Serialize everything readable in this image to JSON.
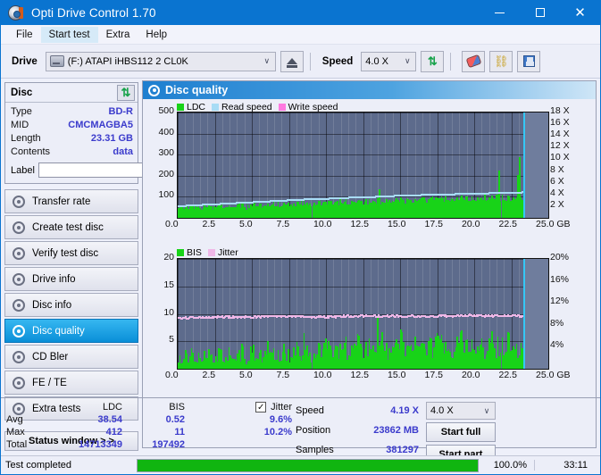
{
  "window": {
    "title": "Opti Drive Control 1.70",
    "icon": "disc-app-icon",
    "minimize": "–",
    "maximize": "□",
    "close": "✕"
  },
  "menu": {
    "items": [
      "File",
      "Start test",
      "Extra",
      "Help"
    ],
    "active": "Start test"
  },
  "toolbar": {
    "drive_label": "Drive",
    "drive_value": "(F:)  ATAPI iHBS112  2 CL0K",
    "eject_icon": "eject-icon",
    "speed_label": "Speed",
    "speed_value": "4.0 X",
    "refresh_icon": "refresh-icon",
    "erase_icon": "erase-icon",
    "chain_icon": "chain-icon",
    "save_icon": "save-icon",
    "caret": "∨"
  },
  "disc": {
    "header": "Disc",
    "refresh_icon": "refresh-icon",
    "rows": [
      {
        "key": "Type",
        "value": "BD-R"
      },
      {
        "key": "MID",
        "value": "CMCMAGBA5"
      },
      {
        "key": "Length",
        "value": "23.31 GB"
      },
      {
        "key": "Contents",
        "value": "data"
      }
    ],
    "label_key": "Label",
    "label_value": "",
    "label_placeholder": "",
    "disc_icon": "cd-icon"
  },
  "nav": {
    "items": [
      {
        "label": "Transfer rate",
        "selected": false
      },
      {
        "label": "Create test disc",
        "selected": false
      },
      {
        "label": "Verify test disc",
        "selected": false
      },
      {
        "label": "Drive info",
        "selected": false
      },
      {
        "label": "Disc info",
        "selected": false
      },
      {
        "label": "Disc quality",
        "selected": true
      },
      {
        "label": "CD Bler",
        "selected": false
      },
      {
        "label": "FE / TE",
        "selected": false
      },
      {
        "label": "Extra tests",
        "selected": false
      }
    ],
    "status_window": "Status window > >"
  },
  "chart_panel": {
    "title": "Disc quality",
    "icon": "disc-quality-icon"
  },
  "stats": {
    "columns": [
      "LDC",
      "BIS"
    ],
    "jitter_label": "Jitter",
    "jitter_checked": true,
    "checkmark": "✓",
    "rows": [
      {
        "name": "Avg",
        "ldc": "38.54",
        "bis": "0.52",
        "jitter": "9.6%"
      },
      {
        "name": "Max",
        "ldc": "412",
        "bis": "11",
        "jitter": "10.2%"
      },
      {
        "name": "Total",
        "ldc": "14713349",
        "bis": "197492",
        "jitter": ""
      }
    ],
    "right": [
      {
        "label": "Speed",
        "value": "4.19 X"
      },
      {
        "label": "Position",
        "value": "23862 MB"
      },
      {
        "label": "Samples",
        "value": "381297"
      }
    ],
    "speed_select": "4.0 X",
    "start_full": "Start full",
    "start_part": "Start part"
  },
  "statusbar": {
    "message": "Test completed",
    "progress_pct": 100,
    "progress_text": "100.0%",
    "elapsed": "33:11"
  },
  "colors": {
    "accent": "#0a74d0",
    "ldc_green": "#18d318",
    "read_speed": "#a8dcf5",
    "write_speed": "#ff7ae0",
    "jitter_pink": "#f0b8e8",
    "plot_bg": "#5d6b8c",
    "value_blue": "#3b3bcc",
    "progress_green": "#10b510"
  },
  "chart_data": [
    {
      "type": "area",
      "id": "disc-quality-ldc",
      "title": "Disc quality",
      "xlabel": "GB",
      "ylabel": "LDC",
      "xlim": [
        0,
        25.0
      ],
      "ylim": [
        0,
        500
      ],
      "y2lim": [
        0,
        18
      ],
      "y2label": "X",
      "xticks": [
        "0.0",
        "2.5",
        "5.0",
        "7.5",
        "10.0",
        "12.5",
        "15.0",
        "17.5",
        "20.0",
        "22.5",
        "25.0 GB"
      ],
      "yticks": [
        100,
        200,
        300,
        400,
        500
      ],
      "y2ticks": [
        "2 X",
        "4 X",
        "6 X",
        "8 X",
        "10 X",
        "12 X",
        "14 X",
        "16 X",
        "18 X"
      ],
      "grid": true,
      "legend": [
        {
          "name": "LDC",
          "color": "#18d318"
        },
        {
          "name": "Read speed",
          "color": "#a8dcf5"
        },
        {
          "name": "Write speed",
          "color": "#ff7ae0"
        }
      ],
      "series": [
        {
          "name": "LDC",
          "color": "#18d318",
          "x": [
            0.1,
            0.4,
            0.7,
            1.0,
            1.3,
            1.6,
            1.9,
            2.2,
            2.5,
            2.8,
            3.1,
            3.4,
            3.7,
            4.0,
            4.3,
            4.6,
            4.9,
            5.2,
            5.5,
            5.8,
            6.1,
            6.4,
            6.7,
            7.0,
            7.3,
            7.6,
            7.9,
            8.2,
            8.5,
            8.8,
            9.1,
            9.4,
            9.7,
            10.0,
            10.3,
            10.6,
            10.9,
            11.2,
            11.5,
            11.8,
            12.1,
            12.4,
            12.7,
            13.0,
            13.3,
            13.6,
            13.9,
            14.2,
            14.5,
            14.8,
            15.1,
            15.4,
            15.7,
            16.0,
            16.3,
            16.6,
            16.9,
            17.2,
            17.5,
            17.8,
            18.1,
            18.4,
            18.7,
            19.0,
            19.3,
            19.6,
            19.9,
            20.2,
            20.5,
            20.8,
            21.1,
            21.4,
            21.7,
            22.0,
            22.3,
            22.6,
            22.9,
            23.2
          ],
          "values": [
            58,
            62,
            55,
            60,
            70,
            64,
            58,
            66,
            72,
            61,
            60,
            75,
            190,
            80,
            68,
            72,
            66,
            90,
            70,
            74,
            68,
            120,
            76,
            82,
            70,
            88,
            74,
            80,
            190,
            78,
            92,
            86,
            76,
            160,
            96,
            84,
            90,
            104,
            88,
            96,
            150,
            92,
            86,
            110,
            100,
            180,
            94,
            96,
            108,
            260,
            102,
            310,
            112,
            100,
            170,
            106,
            120,
            110,
            230,
            118,
            104,
            112,
            124,
            140,
            100,
            108,
            130,
            118,
            112,
            240,
            126,
            116,
            260,
            200,
            132,
            120,
            300,
            330
          ]
        },
        {
          "name": "Read speed",
          "color": "#a8dcf5",
          "x": [
            0.1,
            1.5,
            3.0,
            4.5,
            6.0,
            7.5,
            9.0,
            10.5,
            12.0,
            13.5,
            15.0,
            16.5,
            18.0,
            19.5,
            21.0,
            22.5,
            23.2
          ],
          "values": [
            2.0,
            2.2,
            2.4,
            2.6,
            2.8,
            3.0,
            3.2,
            3.3,
            3.5,
            3.6,
            3.8,
            3.9,
            4.0,
            4.1,
            4.2,
            4.3,
            4.35
          ],
          "axis": "y2"
        }
      ],
      "end_marker_x": 23.3
    },
    {
      "type": "area",
      "id": "disc-quality-bis",
      "xlabel": "GB",
      "ylabel": "BIS",
      "xlim": [
        0,
        25.0
      ],
      "ylim": [
        0,
        20
      ],
      "y2lim": [
        0,
        20
      ],
      "y2label": "%",
      "xticks": [
        "0.0",
        "2.5",
        "5.0",
        "7.5",
        "10.0",
        "12.5",
        "15.0",
        "17.5",
        "20.0",
        "22.5",
        "25.0 GB"
      ],
      "yticks": [
        5,
        10,
        15,
        20
      ],
      "y2ticks": [
        "4%",
        "8%",
        "12%",
        "16%",
        "20%"
      ],
      "grid": true,
      "legend": [
        {
          "name": "BIS",
          "color": "#18d318"
        },
        {
          "name": "Jitter",
          "color": "#f0b8e8"
        }
      ],
      "series": [
        {
          "name": "BIS",
          "color": "#18d318",
          "x": [
            0.1,
            0.4,
            0.7,
            1.0,
            1.3,
            1.6,
            1.9,
            2.2,
            2.5,
            2.8,
            3.1,
            3.4,
            3.7,
            4.0,
            4.3,
            4.6,
            4.9,
            5.2,
            5.5,
            5.8,
            6.1,
            6.4,
            6.7,
            7.0,
            7.3,
            7.6,
            7.9,
            8.2,
            8.5,
            8.8,
            9.1,
            9.4,
            9.7,
            10.0,
            10.3,
            10.6,
            10.9,
            11.2,
            11.5,
            11.8,
            12.1,
            12.4,
            12.7,
            13.0,
            13.3,
            13.6,
            13.9,
            14.2,
            14.5,
            14.8,
            15.1,
            15.4,
            15.7,
            16.0,
            16.3,
            16.6,
            16.9,
            17.2,
            17.5,
            17.8,
            18.1,
            18.4,
            18.7,
            19.0,
            19.3,
            19.6,
            19.9,
            20.2,
            20.5,
            20.8,
            21.1,
            21.4,
            21.7,
            22.0,
            22.3,
            22.6,
            22.9,
            23.2
          ],
          "values": [
            2.0,
            3.0,
            2.2,
            3.4,
            2.6,
            4.0,
            2.4,
            3.2,
            2.8,
            3.6,
            2.2,
            4.2,
            3.0,
            2.6,
            3.8,
            2.4,
            4.4,
            3.2,
            2.8,
            3.6,
            5.0,
            3.0,
            2.6,
            4.2,
            3.4,
            2.8,
            4.6,
            3.0,
            5.2,
            3.4,
            2.8,
            4.0,
            3.6,
            5.4,
            3.0,
            4.2,
            3.4,
            5.0,
            3.8,
            4.4,
            6.0,
            3.6,
            4.0,
            5.2,
            3.4,
            11.0,
            4.6,
            3.8,
            5.0,
            4.2,
            6.2,
            3.6,
            4.8,
            5.6,
            4.0,
            3.8,
            5.4,
            4.2,
            6.0,
            4.6,
            3.8,
            5.0,
            4.4,
            6.4,
            4.0,
            5.2,
            4.6,
            3.8,
            5.8,
            4.2,
            6.6,
            4.4,
            5.0,
            4.0,
            6.8,
            4.6,
            5.2,
            5.8
          ]
        },
        {
          "name": "Jitter",
          "color": "#f0b8e8",
          "x": [
            0.1,
            1.5,
            3.0,
            4.5,
            6.0,
            7.5,
            9.0,
            10.5,
            12.0,
            13.5,
            15.0,
            16.5,
            18.0,
            19.5,
            21.0,
            22.5,
            23.2
          ],
          "values": [
            9.2,
            9.3,
            9.4,
            9.4,
            9.5,
            9.5,
            9.4,
            9.5,
            9.6,
            9.6,
            9.5,
            9.6,
            9.6,
            9.7,
            9.6,
            9.7,
            9.6
          ]
        }
      ],
      "end_marker_x": 23.3
    }
  ]
}
